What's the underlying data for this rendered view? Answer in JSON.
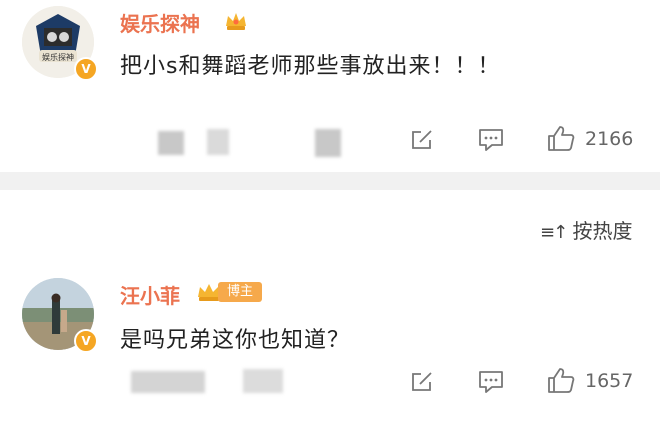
{
  "comments": [
    {
      "username": "娱乐探神",
      "avatar_caption": "娱乐探神",
      "text": "把小s和舞蹈老师那些事放出来！！！",
      "likes": "2166",
      "verified_badge": "V"
    },
    {
      "username": "汪小菲",
      "badge_label": "博主",
      "text": "是吗兄弟这你也知道？",
      "likes": "1657",
      "verified_badge": "V"
    }
  ],
  "sort": {
    "icon": "sort-icon",
    "label": "按热度"
  },
  "colors": {
    "username": "#eb7350",
    "text": "#222222",
    "divider": "#f1f1f1",
    "badge": "#f5a623"
  }
}
